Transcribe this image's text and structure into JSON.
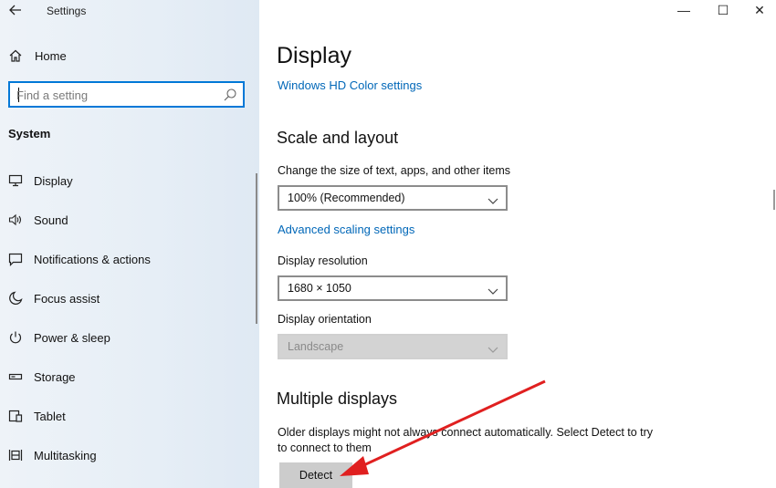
{
  "window": {
    "app_title": "Settings",
    "back_icon": "back-arrow-icon",
    "controls": {
      "minimize": "—",
      "maximize": "☐",
      "close": "✕"
    }
  },
  "sidebar": {
    "home_label": "Home",
    "search_placeholder": "Find a setting",
    "section_title": "System",
    "items": [
      {
        "label": "Display",
        "icon": "monitor-icon"
      },
      {
        "label": "Sound",
        "icon": "speaker-icon"
      },
      {
        "label": "Notifications & actions",
        "icon": "notification-icon"
      },
      {
        "label": "Focus assist",
        "icon": "moon-icon"
      },
      {
        "label": "Power & sleep",
        "icon": "power-icon"
      },
      {
        "label": "Storage",
        "icon": "storage-icon"
      },
      {
        "label": "Tablet",
        "icon": "tablet-icon"
      },
      {
        "label": "Multitasking",
        "icon": "multitasking-icon"
      }
    ]
  },
  "main": {
    "page_title": "Display",
    "hd_color_link": "Windows HD Color settings",
    "scale": {
      "heading": "Scale and layout",
      "size_label": "Change the size of text, apps, and other items",
      "size_value": "100% (Recommended)",
      "advanced_link": "Advanced scaling settings",
      "resolution_label": "Display resolution",
      "resolution_value": "1680 × 1050",
      "orientation_label": "Display orientation",
      "orientation_value": "Landscape"
    },
    "multiple": {
      "heading": "Multiple displays",
      "description": "Older displays might not always connect automatically. Select Detect to try to connect to them",
      "detect_button": "Detect"
    }
  },
  "colors": {
    "accent": "#0078d7",
    "link": "#0067b8",
    "annotation_arrow": "#e02020"
  }
}
